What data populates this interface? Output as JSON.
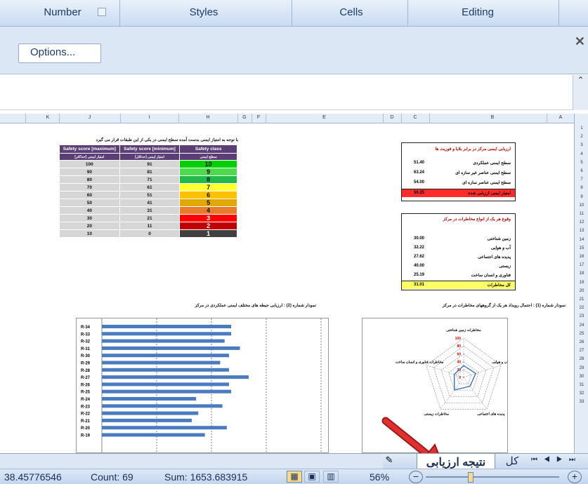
{
  "ribbon": {
    "groups": [
      "Number",
      "Styles",
      "Cells",
      "Editing"
    ]
  },
  "options_bar": {
    "button_label": "Options..."
  },
  "columns": [
    "K",
    "J",
    "I",
    "H",
    "G",
    "F",
    "E",
    "D",
    "C",
    "B",
    "A"
  ],
  "rows": [
    "1",
    "2",
    "3",
    "4",
    "5",
    "6",
    "7",
    "8",
    "9",
    "10",
    "11",
    "12",
    "13",
    "14",
    "15",
    "16",
    "17",
    "18",
    "19",
    "20",
    "21",
    "22",
    "23",
    "24",
    "25",
    "26",
    "27",
    "28",
    "29",
    "30",
    "31",
    "32",
    "33"
  ],
  "safety_table": {
    "title": "با توجه به امتیاز ایمنی بدست آمده سطح ایمنی در یکی از این طبقات قرار می گیرد",
    "headers": [
      "Safety score [maximum]",
      "Safety score [minimum]",
      "Safety class"
    ],
    "subheaders": [
      "امتیاز ایمنی [حداکثر]",
      "امتیاز ایمنی [حداقل]",
      "سطح ایمنی"
    ],
    "rows": [
      {
        "max": "100",
        "min": "91",
        "level": "10",
        "color": "#00d000",
        "text_color": "#111"
      },
      {
        "max": "90",
        "min": "81",
        "level": "9",
        "color": "#4cdb4c",
        "text_color": "#111"
      },
      {
        "max": "80",
        "min": "71",
        "level": "8",
        "color": "#22b84a",
        "text_color": "#111"
      },
      {
        "max": "70",
        "min": "61",
        "level": "7",
        "color": "#ffff33",
        "text_color": "#111"
      },
      {
        "max": "60",
        "min": "51",
        "level": "6",
        "color": "#ffc000",
        "text_color": "#111"
      },
      {
        "max": "50",
        "min": "41",
        "level": "5",
        "color": "#e0a800",
        "text_color": "#111"
      },
      {
        "max": "40",
        "min": "31",
        "level": "4",
        "color": "#e97b2c",
        "text_color": "#111"
      },
      {
        "max": "30",
        "min": "21",
        "level": "3",
        "color": "#ff0000",
        "text_color": "#fff"
      },
      {
        "max": "20",
        "min": "11",
        "level": "2",
        "color": "#c00000",
        "text_color": "#fff"
      },
      {
        "max": "10",
        "min": "0",
        "level": "1",
        "color": "#404040",
        "text_color": "#fff"
      }
    ]
  },
  "hazard_table": {
    "title": "ارزیابی ایمنی مرکز در برابر بلایا و فوریت ها",
    "rows": [
      {
        "value": "51.40",
        "label": "سطح ایمنی عملکردی"
      },
      {
        "value": "63.24",
        "label": "سطح ایمنی عناصر غیر سازه ای"
      },
      {
        "value": "54.00",
        "label": "سطح ایمنی عناصر سازه ای"
      }
    ],
    "total": {
      "value": "56.25",
      "label": "امتیاز ایمنی ارزیابی شده"
    }
  },
  "risk_table": {
    "title": "وقوع هر یک از انواع مخاطرات در مرکز",
    "rows": [
      {
        "value": "30.00",
        "label": "زمین شناختی"
      },
      {
        "value": "32.22",
        "label": "آب و هوایی"
      },
      {
        "value": "27.62",
        "label": "پدیده های اجتماعی"
      },
      {
        "value": "40.00",
        "label": "زیستی"
      },
      {
        "value": "25.19",
        "label": "فناوری و انسان ساخت"
      }
    ],
    "total": {
      "value": "31.01",
      "label": "کل مخاطرات"
    }
  },
  "chart_left": {
    "title": "نمودار شماره (2) : ارزیابی حیطه های مختلف ایمنی عملکردی در مرکز",
    "chart_data": {
      "type": "bar",
      "categories": [
        "R-34",
        "R-33",
        "R-32",
        "R-31",
        "R-30",
        "R-29",
        "R-28",
        "R-27",
        "R-26",
        "R-25",
        "R-24",
        "R-23",
        "R-22",
        "R-21",
        "R-20",
        "R-19"
      ],
      "values": [
        59,
        59,
        56,
        63,
        58,
        54,
        58,
        67,
        58,
        59,
        43,
        55,
        44,
        41,
        57,
        47
      ],
      "xlim": [
        0,
        100
      ]
    }
  },
  "chart_right": {
    "title": "نمودار شماره (1) : احتمال رویداد هر یک از گروههای مخاطرات در مرکز",
    "chart_data": {
      "type": "radar",
      "categories": [
        "مخاطرات زمین شناختی",
        "مخاطرات آب و هوایی",
        "پدیده های اجتماعی",
        "مخاطرات زیستی",
        "مخاطرات فناوری و انسان ساخت"
      ],
      "values": [
        30.0,
        32.22,
        27.62,
        40.0,
        25.19
      ],
      "ticks": [
        "100",
        "80",
        "60",
        "40",
        "20",
        "0"
      ],
      "rlim": [
        0,
        100
      ]
    }
  },
  "sheet_tabs": {
    "active": "نتیجه ارزیابی",
    "other": "کل"
  },
  "status": {
    "average": "38.45776546",
    "count": "Count: 69",
    "sum": "Sum: 1653.683915",
    "zoom": "56%"
  }
}
